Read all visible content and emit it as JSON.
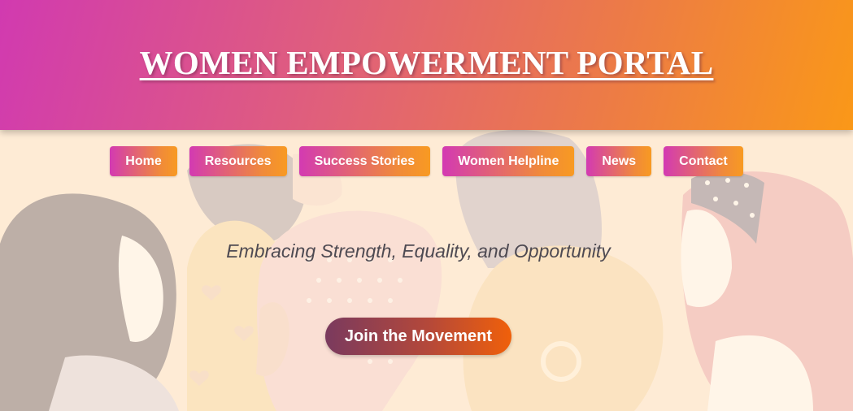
{
  "header": {
    "title": "WOMEN EMPOWERMENT PORTAL"
  },
  "nav": {
    "items": [
      {
        "label": "Home"
      },
      {
        "label": "Resources"
      },
      {
        "label": "Success Stories"
      },
      {
        "label": "Women Helpline"
      },
      {
        "label": "News"
      },
      {
        "label": "Contact"
      }
    ]
  },
  "hero": {
    "tagline": "Embracing Strength, Equality, and Opportunity",
    "cta_label": "Join the Movement"
  },
  "background": {
    "illustration": "women-silhouettes-illustration"
  },
  "colors": {
    "header_gradient_start": "#d13ab0",
    "header_gradient_end": "#fa9818",
    "page_background": "#fde9d6",
    "cta_gradient_start": "#7a3a5e",
    "cta_gradient_end": "#f0600a"
  }
}
